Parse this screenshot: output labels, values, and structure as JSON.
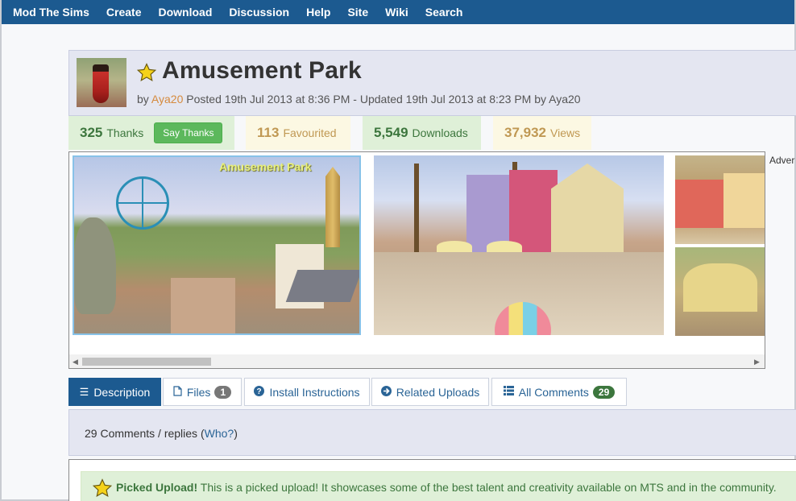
{
  "nav": {
    "items": [
      "Mod The Sims",
      "Create",
      "Download",
      "Discussion",
      "Help",
      "Site",
      "Wiki",
      "Search"
    ]
  },
  "header": {
    "title": "Amusement Park",
    "by_prefix": "by",
    "author": "Aya20",
    "posted_text": "Posted 19th Jul 2013 at 8:36 PM - Updated 19th Jul 2013 at 8:23 PM by Aya20"
  },
  "stats": {
    "thanks": {
      "count": "325",
      "label": "Thanks",
      "button": "Say Thanks"
    },
    "favourited": {
      "count": "113",
      "label": "Favourited"
    },
    "downloads": {
      "count": "5,549",
      "label": "Downloads"
    },
    "views": {
      "count": "37,932",
      "label": "Views"
    }
  },
  "gallery": {
    "caption": "Amusement Park",
    "advert_label": "Adver"
  },
  "tabs": [
    {
      "label": "Description",
      "icon": "list-icon",
      "active": true
    },
    {
      "label": "Files",
      "icon": "file-icon",
      "badge": "1"
    },
    {
      "label": "Install Instructions",
      "icon": "question-icon"
    },
    {
      "label": "Related Uploads",
      "icon": "arrow-circle-icon"
    },
    {
      "label": "All Comments",
      "icon": "grid-list-icon",
      "badge": "29"
    }
  ],
  "comments": {
    "summary": "29 Comments / replies",
    "who_link": "Who?"
  },
  "picked": {
    "title": "Picked Upload!",
    "message": "This is a picked upload! It showcases some of the best talent and creativity available on MTS and in the community."
  },
  "colors": {
    "nav_bg": "#1c5a90",
    "success_text": "#3c763d",
    "success_bg": "#dff0d8",
    "warning_text": "#c09853",
    "warning_bg": "#fcf8e3",
    "author": "#d58a3d"
  }
}
